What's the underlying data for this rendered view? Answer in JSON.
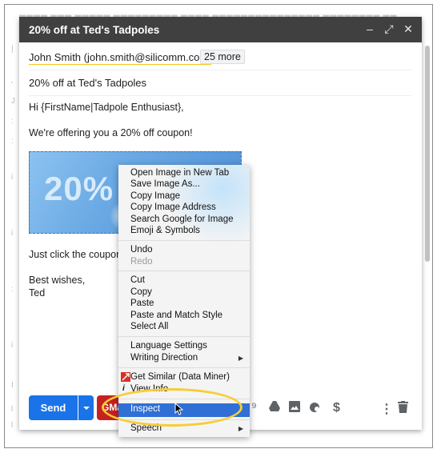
{
  "compose": {
    "title": "20% off at Ted's Tadpoles",
    "window_controls": [
      "minimize-icon",
      "expand-icon",
      "close-icon"
    ],
    "recipients": "John Smith (john.smith@silicomm.com)",
    "more_recipients": "25 more",
    "subject": "20% off at Ted's Tadpoles",
    "body": {
      "greeting": "Hi {FirstName|Tadpole Enthusiast},",
      "line1": "We're offering you a 20% off coupon!",
      "coupon_text": "20%",
      "line2": "Just click the coupon to",
      "signoff": "Best wishes,",
      "name": "Ted"
    },
    "send_label": "Send",
    "gmass_label": "GMa",
    "toolbar_icons": [
      "attach-icon",
      "drive-icon",
      "photo-icon",
      "confidential-icon",
      "money-icon",
      "more-options-icon",
      "trash-icon"
    ]
  },
  "context_menu": {
    "group1": [
      "Open Image in New Tab",
      "Save Image As...",
      "Copy Image",
      "Copy Image Address",
      "Search Google for Image",
      "Emoji & Symbols"
    ],
    "group2": [
      "Undo",
      "Redo"
    ],
    "group3": [
      "Cut",
      "Copy",
      "Paste",
      "Paste and Match Style",
      "Select All"
    ],
    "group4": [
      "Language Settings",
      "Writing Direction"
    ],
    "group5": [
      "Get Similar (Data Miner)",
      "View Info"
    ],
    "inspect": "Inspect",
    "speech": "Speech"
  },
  "colors": {
    "titlebar": "#404040",
    "send": "#1a73e8",
    "gmass": "#c5221f",
    "highlight": "#2f6fd6",
    "annotation": "#f6cd35"
  }
}
